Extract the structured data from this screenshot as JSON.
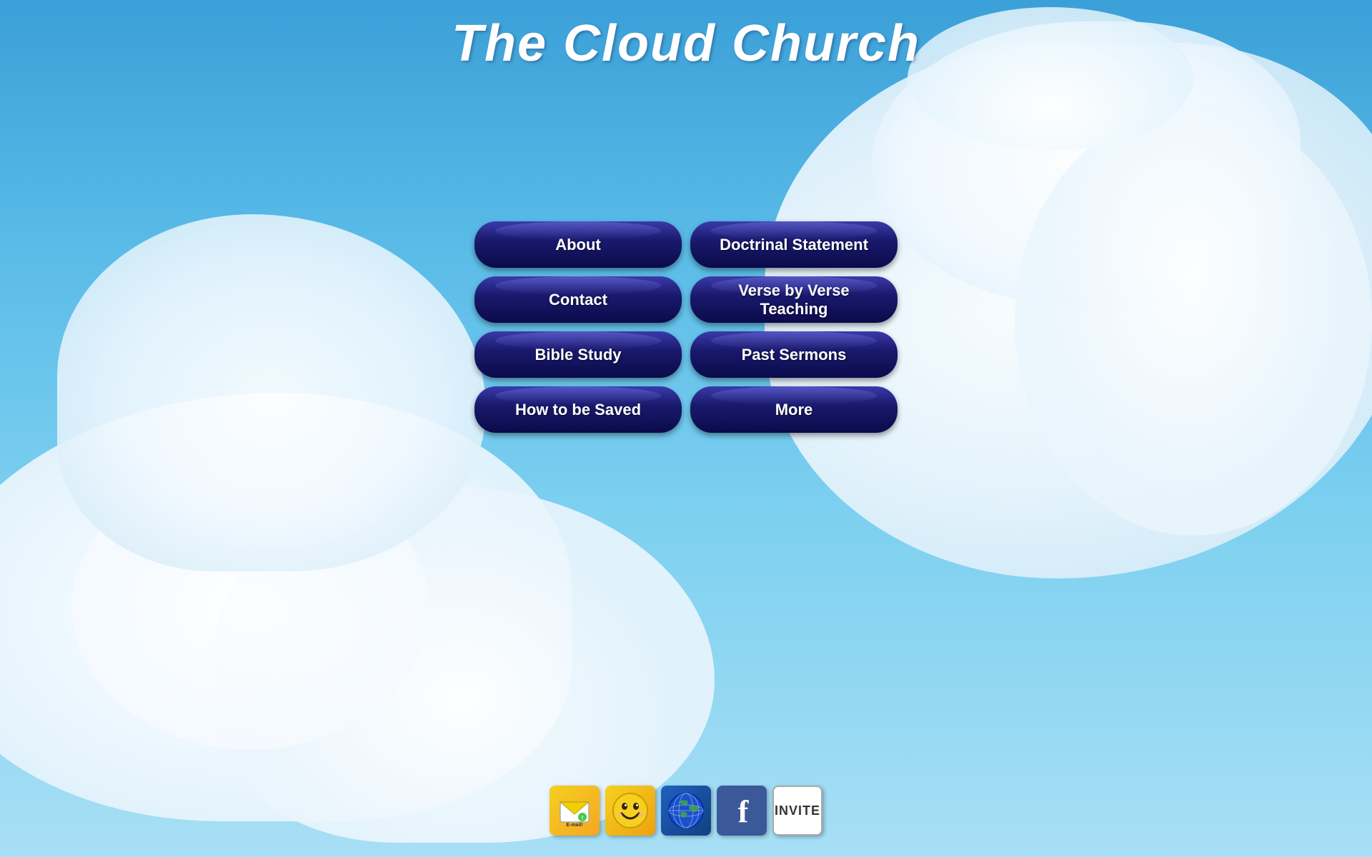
{
  "site": {
    "title": "The Cloud Church"
  },
  "nav": {
    "buttons": [
      {
        "id": "about",
        "label": "About",
        "col": 1,
        "row": 1
      },
      {
        "id": "doctrinal-statement",
        "label": "Doctrinal Statement",
        "col": 2,
        "row": 1
      },
      {
        "id": "contact",
        "label": "Contact",
        "col": 1,
        "row": 2
      },
      {
        "id": "verse-by-verse",
        "label": "Verse by Verse Teaching",
        "col": 2,
        "row": 2
      },
      {
        "id": "bible-study",
        "label": "Bible Study",
        "col": 1,
        "row": 3
      },
      {
        "id": "past-sermons",
        "label": "Past Sermons",
        "col": 2,
        "row": 3
      },
      {
        "id": "how-to-be-saved",
        "label": "How to be Saved",
        "col": 1,
        "row": 4
      },
      {
        "id": "more",
        "label": "More",
        "col": 2,
        "row": 4
      }
    ]
  },
  "bottomBar": {
    "icons": [
      {
        "id": "email",
        "label": "E-mail!",
        "type": "email"
      },
      {
        "id": "smiley",
        "label": "Smiley",
        "type": "smiley"
      },
      {
        "id": "globe",
        "label": "Globe",
        "type": "globe"
      },
      {
        "id": "facebook",
        "label": "Facebook",
        "type": "facebook"
      },
      {
        "id": "invite",
        "label": "INVITE",
        "type": "invite"
      }
    ]
  }
}
